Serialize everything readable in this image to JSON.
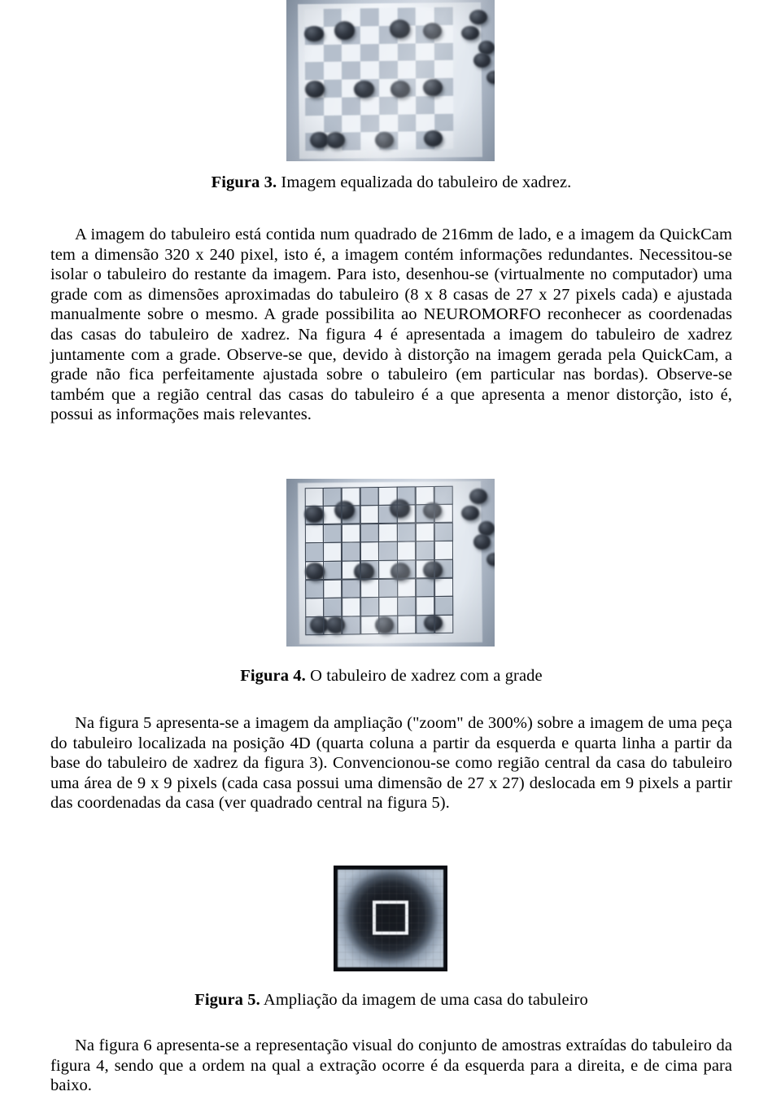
{
  "document": {
    "language": "pt-BR",
    "figure3": {
      "caption_label": "Figura 3.",
      "caption_text": " Imagem equalizada do tabuleiro de xadrez.",
      "alt": "chessboard-photo-equalized"
    },
    "paragraph1": "A imagem do tabuleiro está contida num quadrado de 216mm de lado, e a imagem da QuickCam tem a dimensão 320 x 240 pixel, isto é, a imagem contém informações redundantes. Necessitou-se isolar o tabuleiro do restante da imagem. Para isto, desenhou-se (virtualmente no computador) uma grade com as dimensões aproximadas do tabuleiro (8 x 8 casas de 27 x 27 pixels cada) e ajustada manualmente sobre o mesmo. A grade possibilita ao NEUROMORFO reconhecer as coordenadas das casas do tabuleiro de xadrez. Na figura 4 é apresentada a imagem do tabuleiro de xadrez juntamente com a grade. Observe-se que, devido à distorção na imagem gerada pela QuickCam, a grade não fica perfeitamente ajustada sobre o tabuleiro (em particular nas bordas). Observe-se também que a região central das casas do tabuleiro é a que apresenta a menor distorção, isto é, possui as informações mais relevantes.",
    "figure4": {
      "caption_label": "Figura 4.",
      "caption_text": "  O tabuleiro de xadrez com a grade",
      "alt": "chessboard-photo-with-grid"
    },
    "paragraph2": "Na figura 5 apresenta-se a imagem da ampliação (\"zoom\" de 300%) sobre a imagem de uma peça do tabuleiro localizada na posição 4D (quarta coluna a partir da esquerda e quarta linha a partir da base do tabuleiro de xadrez da figura 3). Convencionou-se como região central da casa do tabuleiro uma área de 9 x 9 pixels (cada casa possui uma dimensão de 27 x 27) deslocada em 9 pixels a partir das coordenadas da casa (ver quadrado central na figura 5).",
    "figure5": {
      "caption_label": "Figura 5.",
      "caption_text": " Ampliação da imagem de uma casa do tabuleiro",
      "alt": "zoomed-board-square-with-center-square"
    },
    "paragraph3": "Na figura  6 apresenta-se a representação visual do conjunto de amostras extraídas do tabuleiro da figura  4, sendo que a ordem na qual a extração ocorre é da esquerda para a direita, e de cima para baixo."
  }
}
